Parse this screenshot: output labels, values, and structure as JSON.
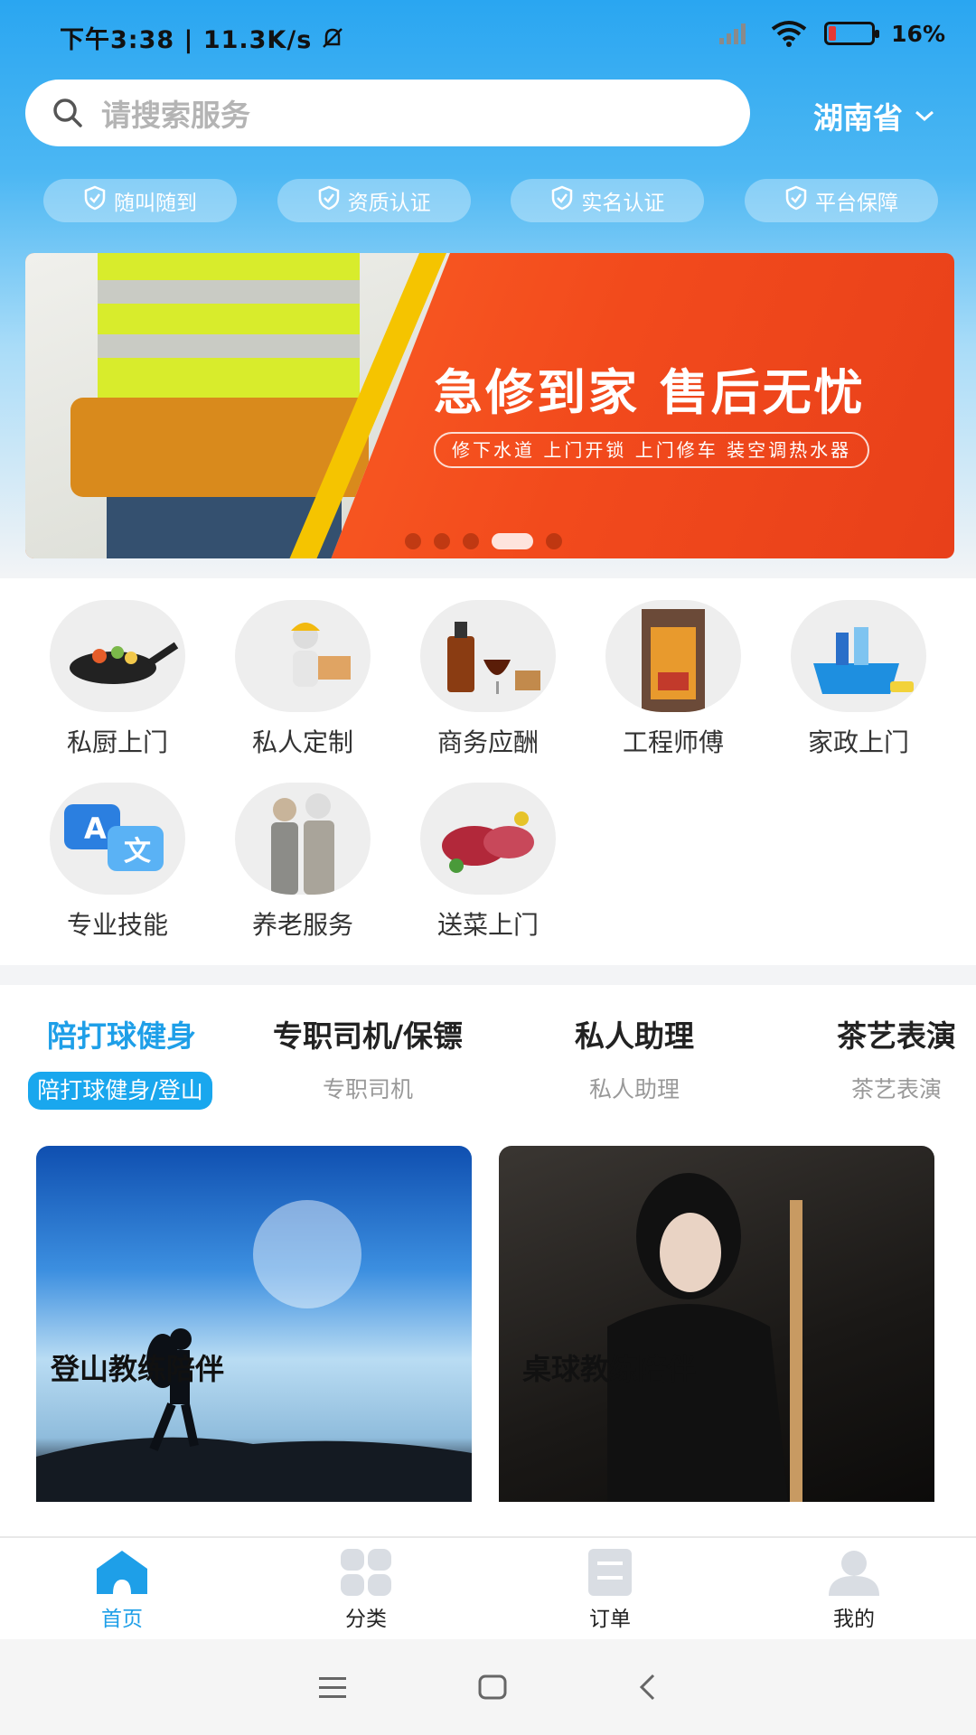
{
  "status_bar": {
    "time_speed": "下午3:38 | 11.3K/s",
    "battery": "16%",
    "battery_level": 0.16
  },
  "search": {
    "placeholder": "请搜索服务"
  },
  "region": {
    "label": "湖南省"
  },
  "badges": [
    "随叫随到",
    "资质认证",
    "实名认证",
    "平台保障"
  ],
  "banner": {
    "title": "急修到家 售后无忧",
    "subtitle": "修下水道 上门开锁 上门修车 装空调热水器",
    "page_count": 5,
    "active_page": 4
  },
  "categories": [
    {
      "label": "私厨上门",
      "icon": "wok-icon"
    },
    {
      "label": "私人定制",
      "icon": "builder-icon"
    },
    {
      "label": "商务应酬",
      "icon": "liquor-icon"
    },
    {
      "label": "工程师傅",
      "icon": "workman-icon"
    },
    {
      "label": "家政上门",
      "icon": "cleaning-icon"
    },
    {
      "label": "专业技能",
      "icon": "translate-icon"
    },
    {
      "label": "养老服务",
      "icon": "elderly-icon"
    },
    {
      "label": "送菜上门",
      "icon": "meat-icon"
    }
  ],
  "tabs": [
    {
      "title": "陪打球健身",
      "sub": "陪打球健身/登山",
      "active": true
    },
    {
      "title": "专职司机/保镖",
      "sub": "专职司机"
    },
    {
      "title": "私人助理",
      "sub": "私人助理"
    },
    {
      "title": "茶艺表演",
      "sub": "茶艺表演"
    }
  ],
  "cards": [
    {
      "title": "登山教练陪伴"
    },
    {
      "title": "桌球教练陪伴"
    }
  ],
  "bottom_nav": [
    {
      "label": "首页",
      "icon": "home-icon",
      "active": true
    },
    {
      "label": "分类",
      "icon": "grid-icon"
    },
    {
      "label": "订单",
      "icon": "order-icon"
    },
    {
      "label": "我的",
      "icon": "profile-icon"
    }
  ],
  "colors": {
    "accent": "#1e9fe8",
    "banner": "#f24a1c"
  }
}
